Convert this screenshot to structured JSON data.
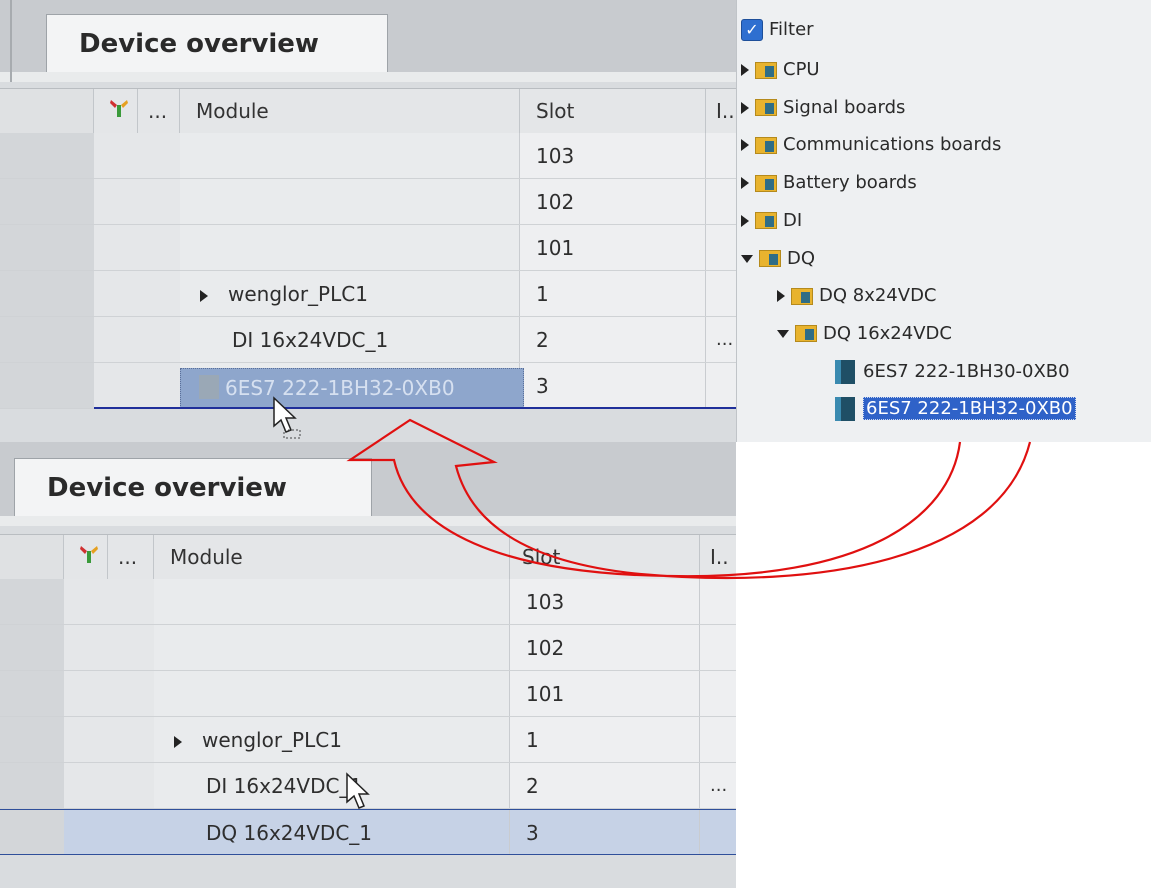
{
  "top_panel": {
    "tab_title": "Device overview",
    "columns": {
      "icon_col": "wrench-icon",
      "dots": "...",
      "module": "Module",
      "slot": "Slot",
      "io": "I.."
    },
    "rows": [
      {
        "expander": "",
        "module": "",
        "slot": "103",
        "io": ""
      },
      {
        "expander": "",
        "module": "",
        "slot": "102",
        "io": ""
      },
      {
        "expander": "",
        "module": "",
        "slot": "101",
        "io": ""
      },
      {
        "expander": "collapsed",
        "module": "wenglor_PLC1",
        "slot": "1",
        "io": ""
      },
      {
        "expander": "",
        "module": "DI 16x24VDC_1",
        "slot": "2",
        "io": "..."
      },
      {
        "expander": "",
        "module": "6ES7 222-1BH32-0XB0",
        "slot": "3",
        "io": ""
      }
    ]
  },
  "catalog": {
    "filter_label": "Filter",
    "filter_checked": true,
    "items": [
      {
        "label": "CPU",
        "expanded": false,
        "level": 0,
        "kind": "folder"
      },
      {
        "label": "Signal boards",
        "expanded": false,
        "level": 0,
        "kind": "folder"
      },
      {
        "label": "Communications boards",
        "expanded": false,
        "level": 0,
        "kind": "folder"
      },
      {
        "label": "Battery boards",
        "expanded": false,
        "level": 0,
        "kind": "folder"
      },
      {
        "label": "DI",
        "expanded": false,
        "level": 0,
        "kind": "folder"
      },
      {
        "label": "DQ",
        "expanded": true,
        "level": 0,
        "kind": "folder"
      },
      {
        "label": "DQ 8x24VDC",
        "expanded": false,
        "level": 1,
        "kind": "folder"
      },
      {
        "label": "DQ 16x24VDC",
        "expanded": true,
        "level": 1,
        "kind": "folder"
      },
      {
        "label": "6ES7 222-1BH30-0XB0",
        "level": 2,
        "kind": "module"
      },
      {
        "label": "6ES7 222-1BH32-0XB0",
        "level": 2,
        "kind": "module",
        "selected": true
      }
    ]
  },
  "bottom_panel": {
    "tab_title": "Device overview",
    "columns": {
      "icon_col": "wrench-icon",
      "dots": "...",
      "module": "Module",
      "slot": "Slot",
      "io": "I.."
    },
    "rows": [
      {
        "expander": "",
        "module": "",
        "slot": "103",
        "io": ""
      },
      {
        "expander": "",
        "module": "",
        "slot": "102",
        "io": ""
      },
      {
        "expander": "",
        "module": "",
        "slot": "101",
        "io": ""
      },
      {
        "expander": "collapsed",
        "module": "wenglor_PLC1",
        "slot": "1",
        "io": ""
      },
      {
        "expander": "",
        "module": "DI 16x24VDC_1",
        "slot": "2",
        "io": "..."
      },
      {
        "expander": "",
        "module": "DQ 16x24VDC_1",
        "slot": "3",
        "io": "",
        "selected": true
      }
    ]
  },
  "colors": {
    "arrow": "#e01010",
    "selection": "#2f62c8",
    "insert_line": "#1f2f9a"
  }
}
